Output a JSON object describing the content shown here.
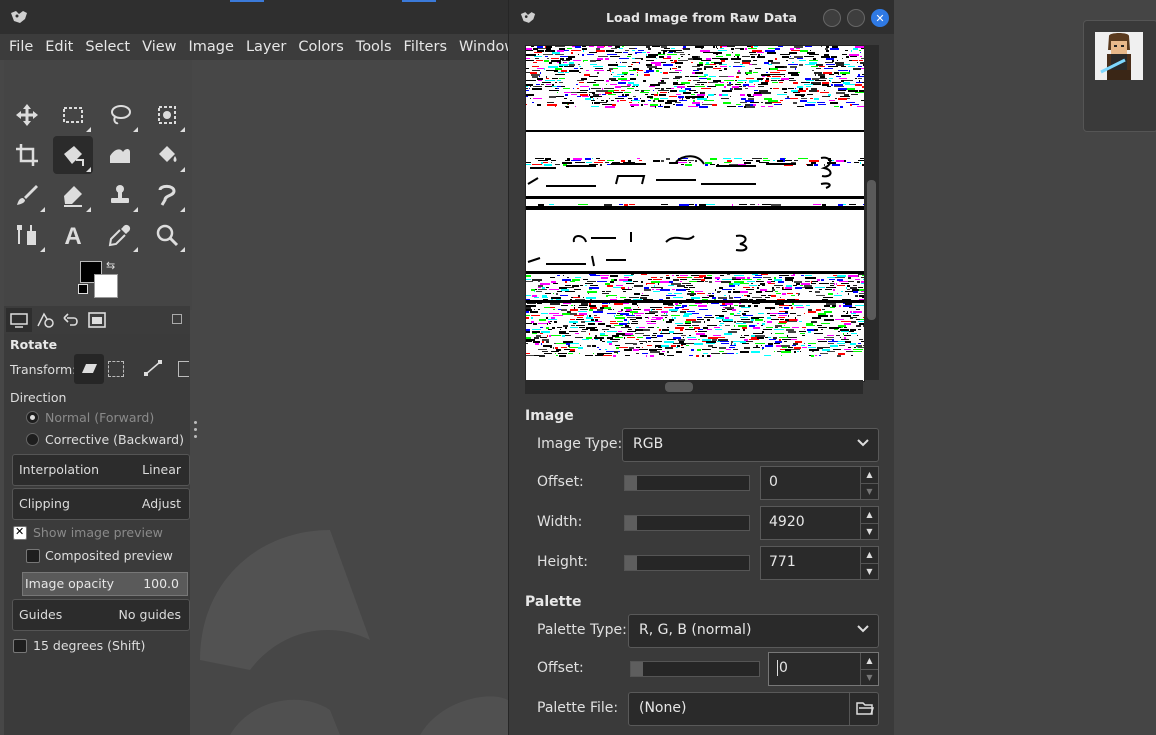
{
  "gimp": {
    "menu": [
      "File",
      "Edit",
      "Select",
      "View",
      "Image",
      "Layer",
      "Colors",
      "Tools",
      "Filters",
      "Windows"
    ]
  },
  "tool_options": {
    "title": "Rotate",
    "transform_label": "Transform:",
    "direction_label": "Direction",
    "direction_normal": "Normal (Forward)",
    "direction_corrective": "Corrective (Backward)",
    "interpolation_label": "Interpolation",
    "interpolation_value": "Linear",
    "clipping_label": "Clipping",
    "clipping_value": "Adjust",
    "show_preview": "Show image preview",
    "composited_preview": "Composited preview",
    "opacity_label": "Image opacity",
    "opacity_value": "100.0",
    "guides_label": "Guides",
    "guides_value": "No guides",
    "degrees_label": "15 degrees (Shift)"
  },
  "dialog": {
    "title": "Load Image from Raw Data",
    "image_section": "Image",
    "image_type_label": "Image Type:",
    "image_type_value": "RGB",
    "offset_label": "Offset:",
    "offset_value": "0",
    "width_label": "Width:",
    "width_value": "4920",
    "height_label": "Height:",
    "height_value": "771",
    "palette_section": "Palette",
    "palette_type_label": "Palette Type:",
    "palette_type_value": "R, G, B (normal)",
    "palette_offset_label": "Offset:",
    "palette_offset_value": "0",
    "palette_file_label": "Palette File:",
    "palette_file_value": "(None)"
  },
  "colors": {
    "accent": "#2f7ae5",
    "foreground": "#000000",
    "background": "#ffffff"
  }
}
